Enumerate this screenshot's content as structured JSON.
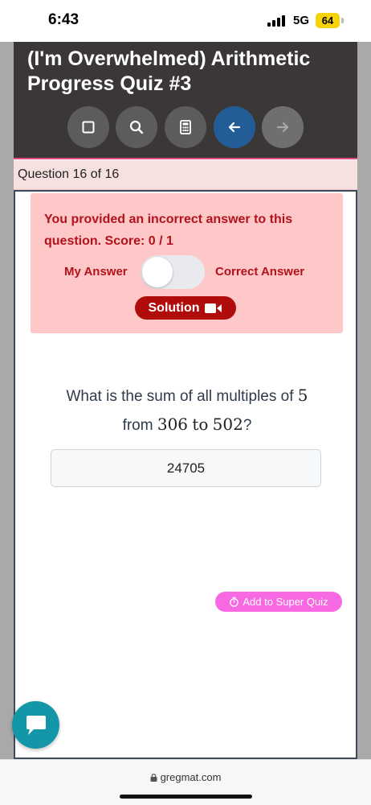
{
  "status_bar": {
    "time": "6:43",
    "network": "5G",
    "battery": "64"
  },
  "quiz": {
    "title": "(I'm Overwhelmed) Arithmetic Progress Quiz #3",
    "toolbar": [
      {
        "icon": "square-icon"
      },
      {
        "icon": "search-icon"
      },
      {
        "icon": "calculator-icon"
      },
      {
        "icon": "arrow-left-icon"
      },
      {
        "icon": "arrow-right-icon"
      }
    ],
    "accent_color": "#235d97",
    "question_counter": "Question 16 of 16"
  },
  "feedback": {
    "message": "You provided an incorrect answer to this question. Score: 0 / 1",
    "toggle_left_label": "My Answer",
    "toggle_right_label": "Correct Answer",
    "solution_label": "Solution",
    "error_color": "#b3121c"
  },
  "question": {
    "text_before": "What is the sum of all multiples of",
    "multiple": "5",
    "text_from": "from",
    "start": "306",
    "text_to": "to",
    "end": "502",
    "text_end": "?"
  },
  "answer": {
    "value": "24705"
  },
  "super_quiz": {
    "label": "Add to Super Quiz"
  },
  "browser": {
    "url": "gregmat.com"
  }
}
